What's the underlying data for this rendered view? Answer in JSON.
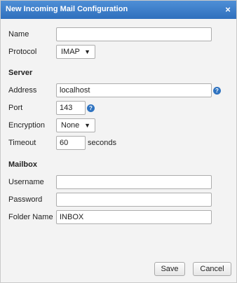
{
  "dialog": {
    "title": "New Incoming Mail Configuration",
    "close_label": "×"
  },
  "general": {
    "name_label": "Name",
    "name_value": "",
    "protocol_label": "Protocol",
    "protocol_value": "IMAP"
  },
  "server": {
    "heading": "Server",
    "address_label": "Address",
    "address_value": "localhost",
    "port_label": "Port",
    "port_value": "143",
    "encryption_label": "Encryption",
    "encryption_value": "None",
    "timeout_label": "Timeout",
    "timeout_value": "60",
    "timeout_unit": "seconds"
  },
  "mailbox": {
    "heading": "Mailbox",
    "username_label": "Username",
    "username_value": "",
    "password_label": "Password",
    "password_value": "",
    "folder_label": "Folder Name",
    "folder_value": "INBOX"
  },
  "icons": {
    "help": "?",
    "dropdown": "▼"
  },
  "buttons": {
    "save": "Save",
    "cancel": "Cancel"
  },
  "colors": {
    "titlebar": "#3a7cc9",
    "help_icon": "#2f73c0"
  }
}
